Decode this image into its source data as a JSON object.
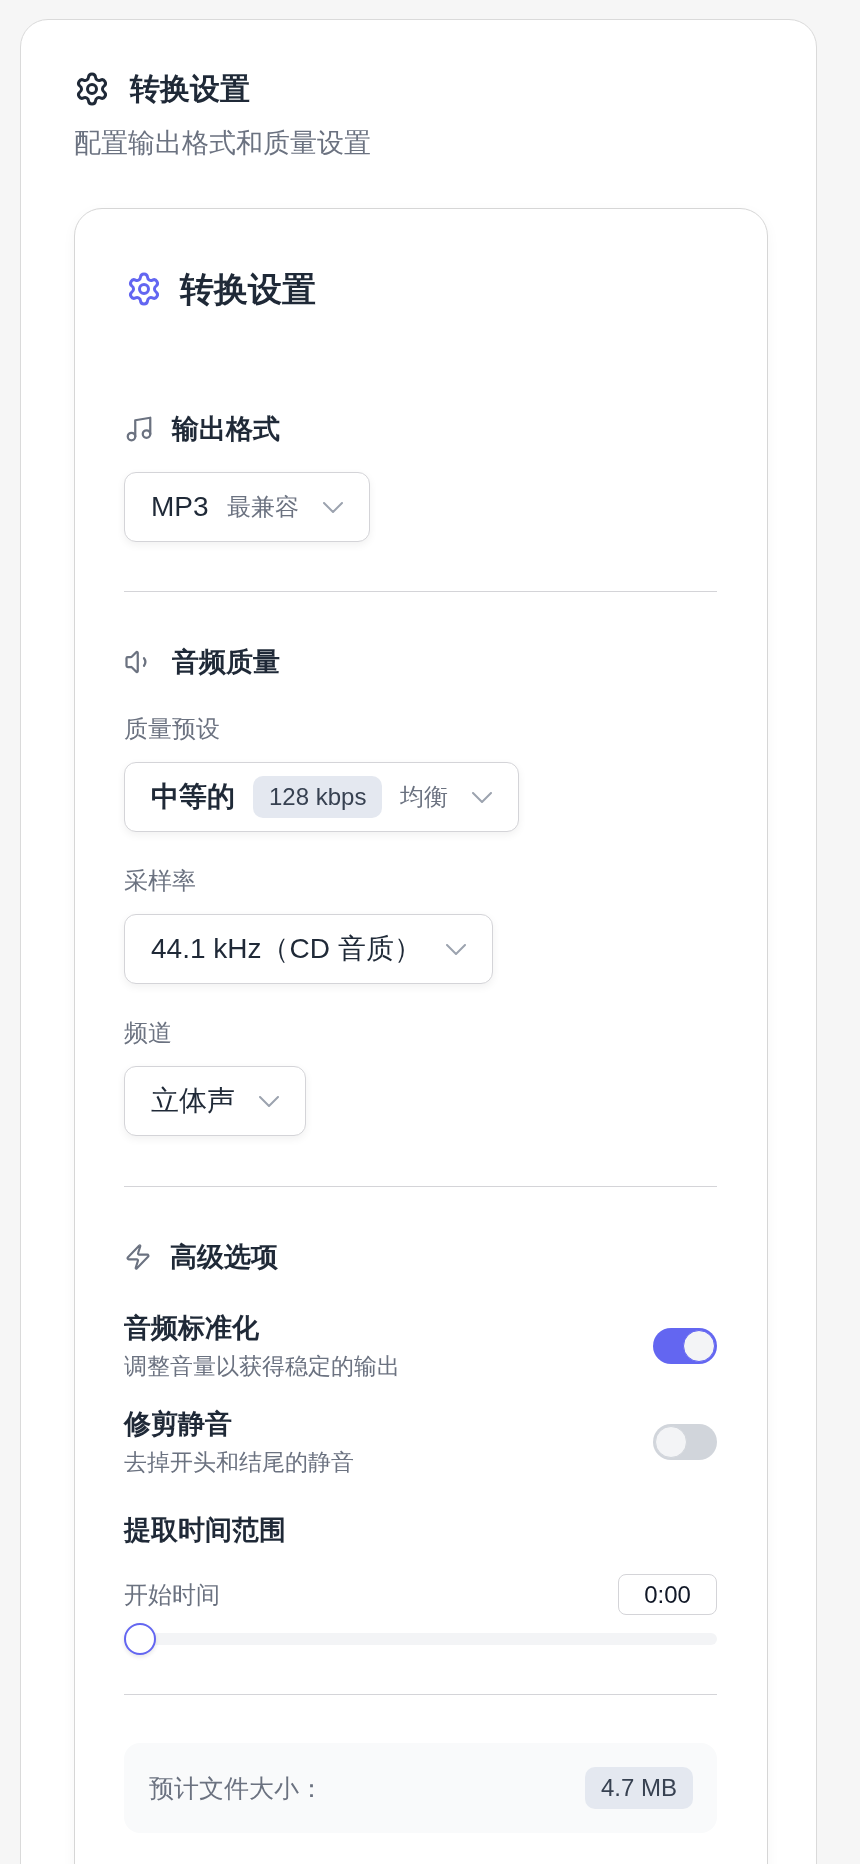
{
  "header": {
    "title": "转换设置",
    "subtitle": "配置输出格式和质量设置"
  },
  "panel": {
    "title": "转换设置"
  },
  "output_format": {
    "title": "输出格式",
    "select": {
      "value": "MP3",
      "hint": "最兼容"
    }
  },
  "audio_quality": {
    "title": "音频质量",
    "fields": [
      {
        "label": "质量预设",
        "value": "中等的",
        "badge": "128 kbps",
        "hint": "均衡"
      },
      {
        "label": "采样率",
        "value": "44.1 kHz（CD 音质）"
      },
      {
        "label": "频道",
        "value": "立体声"
      }
    ]
  },
  "advanced": {
    "title": "高级选项",
    "toggles": [
      {
        "label": "音频标准化",
        "description": "调整音量以获得稳定的输出",
        "on": true
      },
      {
        "label": "修剪静音",
        "description": "去掉开头和结尾的静音",
        "on": false
      }
    ],
    "time_range": {
      "title": "提取时间范围",
      "start": {
        "label": "开始时间",
        "value": "0:00",
        "level": 0
      }
    }
  },
  "estimate": {
    "label": "预计文件大小：",
    "value": "4.7 MB"
  }
}
